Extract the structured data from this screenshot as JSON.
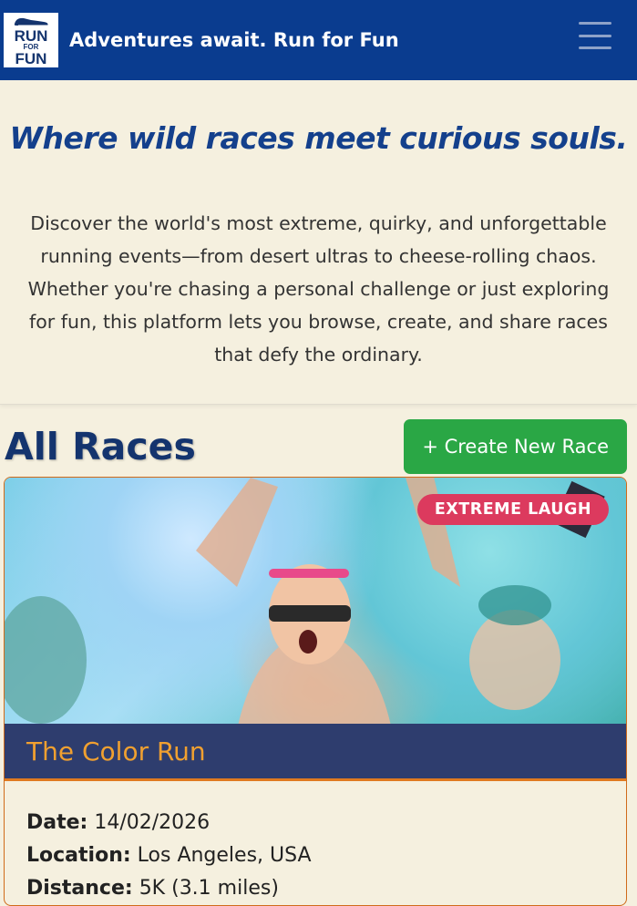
{
  "header": {
    "logo_text": [
      "RUN",
      "FOR",
      "FUN"
    ],
    "title": "Adventures await. Run for Fun",
    "menu_icon": "hamburger-menu-icon"
  },
  "hero": {
    "tagline": "Where wild races meet curious souls.",
    "description": "Discover the world's most extreme, quirky, and unforgettable running events—from desert ultras to cheese-rolling chaos. Whether you're chasing a personal challenge or just exploring for fun, this platform lets you browse, create, and share races that defy the ordinary."
  },
  "races": {
    "heading": "All Races",
    "create_button": "+ Create New Race",
    "items": [
      {
        "badge": "EXTREME LAUGH",
        "name": "The Color Run",
        "date_label": "Date:",
        "date": "14/02/2026",
        "location_label": "Location:",
        "location": "Los Angeles, USA",
        "distance_label": "Distance:",
        "distance": "5K (3.1 miles)"
      }
    ]
  },
  "colors": {
    "navbar": "#0a3c8f",
    "background": "#f5f0df",
    "accent_green": "#2aa745",
    "badge": "#dc3a5e",
    "card_title_bg": "#2e3d6e",
    "card_title_text": "#f0a030"
  }
}
